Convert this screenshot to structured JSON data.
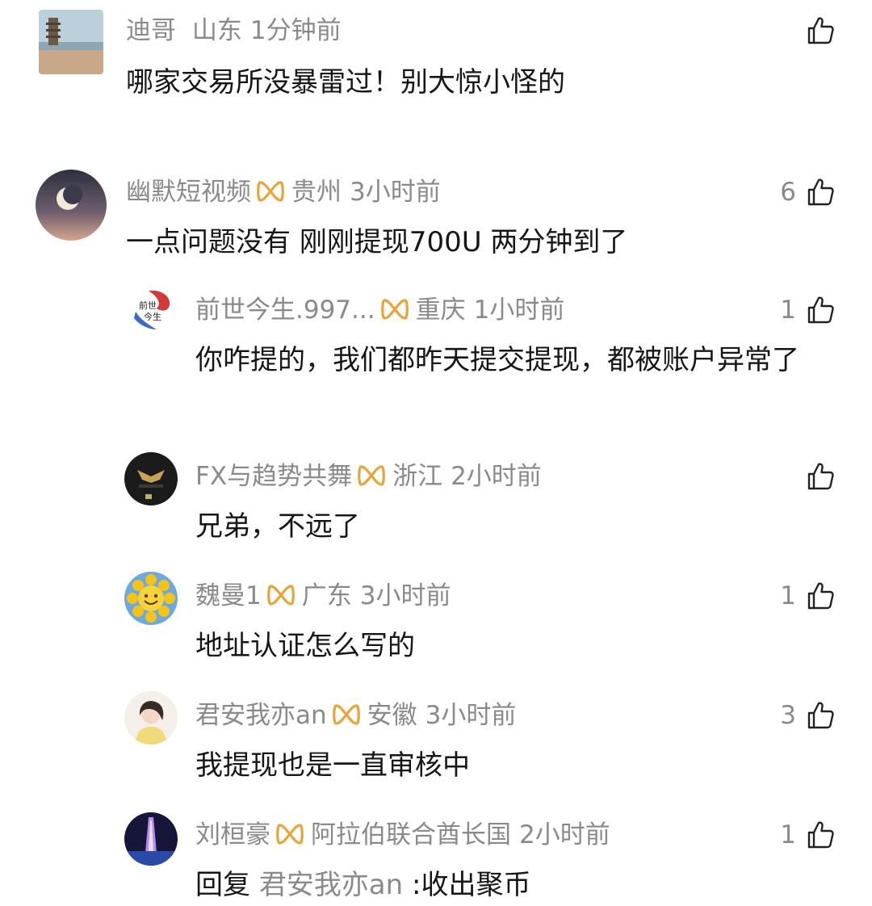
{
  "colors": {
    "meta_gray": "#8a8a8a",
    "text_dark": "#161616",
    "badge_gold": "#e6a43b"
  },
  "comments": [
    {
      "name": "迪哥",
      "location": "山东",
      "time": "1分钟前",
      "likes": "",
      "text": "哪家交易所没暴雷过！别大惊小怪的",
      "has_badge": false
    },
    {
      "name": "幽默短视频",
      "location": "贵州",
      "time": "3小时前",
      "likes": "6",
      "text": "一点问题没有 刚刚提现700U 两分钟到了",
      "has_badge": true
    }
  ],
  "replies": [
    {
      "name": "前世今生.997...",
      "location": "重庆",
      "time": "1小时前",
      "likes": "1",
      "text": "你咋提的，我们都昨天提交提现，都被账户异常了"
    },
    {
      "name": "FX与趋势共舞",
      "location": "浙江",
      "time": "2小时前",
      "likes": "",
      "text": "兄弟，不远了"
    },
    {
      "name": "魏曼1",
      "location": "广东",
      "time": "3小时前",
      "likes": "1",
      "text": "地址认证怎么写的"
    },
    {
      "name": "君安我亦an",
      "location": "安徽",
      "time": "3小时前",
      "likes": "3",
      "text": "我提现也是一直审核中"
    },
    {
      "name": "刘桓豪",
      "location": "阿拉伯联合酋长国",
      "time": "2小时前",
      "likes": "1",
      "reply_prefix": "回复",
      "reply_target": "君安我亦an",
      "text": ":收出聚币"
    }
  ]
}
